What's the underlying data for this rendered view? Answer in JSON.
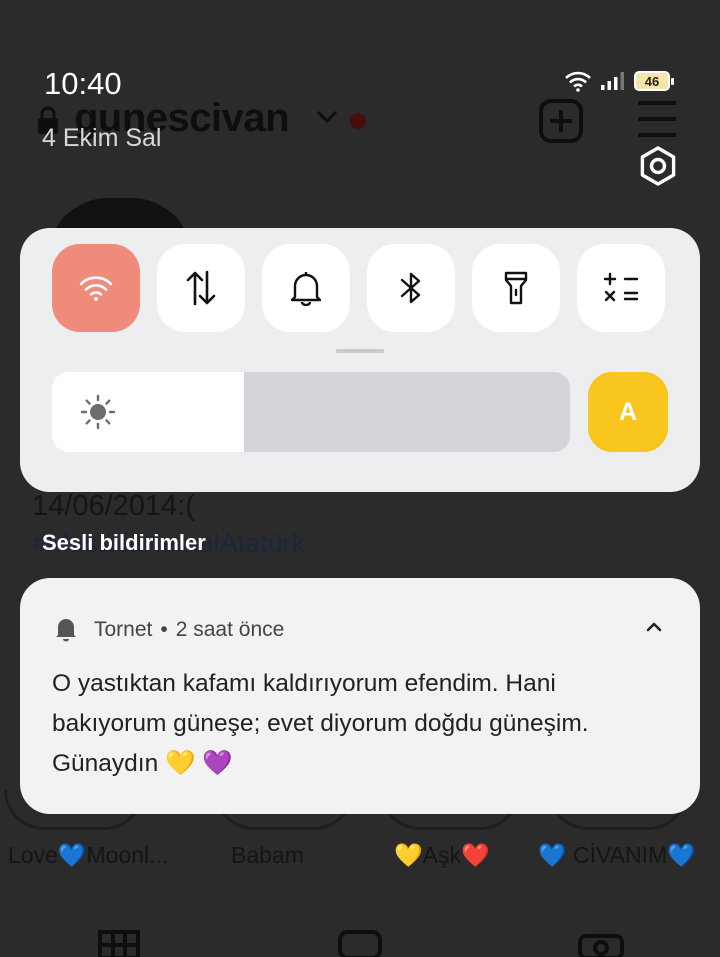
{
  "background_app": {
    "username": "gunescivan",
    "bio_date": "14/06/2014:(",
    "bio_hashtag": "#MustafaKemalAtatürk",
    "highlights": [
      {
        "label": "Love💙Moonl..."
      },
      {
        "label": "Babam"
      },
      {
        "label": "💛Aşk❤️"
      },
      {
        "label": "💙 CİVANIM💙"
      }
    ]
  },
  "status_bar": {
    "time": "10:40",
    "date": "4 Ekim Sal",
    "battery_level": "46",
    "icons": [
      "wifi-icon",
      "signal-icon",
      "battery-icon"
    ]
  },
  "quick_settings": {
    "tiles": [
      {
        "name": "wifi",
        "icon": "wifi-icon",
        "active": true
      },
      {
        "name": "mobile-data",
        "icon": "data-arrows-icon",
        "active": false
      },
      {
        "name": "sound",
        "icon": "bell-icon",
        "active": false
      },
      {
        "name": "bluetooth",
        "icon": "bluetooth-icon",
        "active": false
      },
      {
        "name": "flashlight",
        "icon": "flashlight-icon",
        "active": false
      },
      {
        "name": "calculator",
        "icon": "calculator-icon",
        "active": false
      }
    ],
    "brightness_level": 0.37,
    "auto_brightness_label": "A",
    "accent_active": "#ee8b7b",
    "accent_auto": "#f9c51f"
  },
  "notifications": {
    "section_title": "Sesli bildirimler",
    "items": [
      {
        "app": "Tornet",
        "separator": "•",
        "time": "2 saat önce",
        "body": "O yastıktan kafamı kaldırıyorum efendim. Hani\nbakıyorum güneşe; evet diyorum doğdu güneşim.\nGünaydın 💛 💜"
      }
    ]
  }
}
